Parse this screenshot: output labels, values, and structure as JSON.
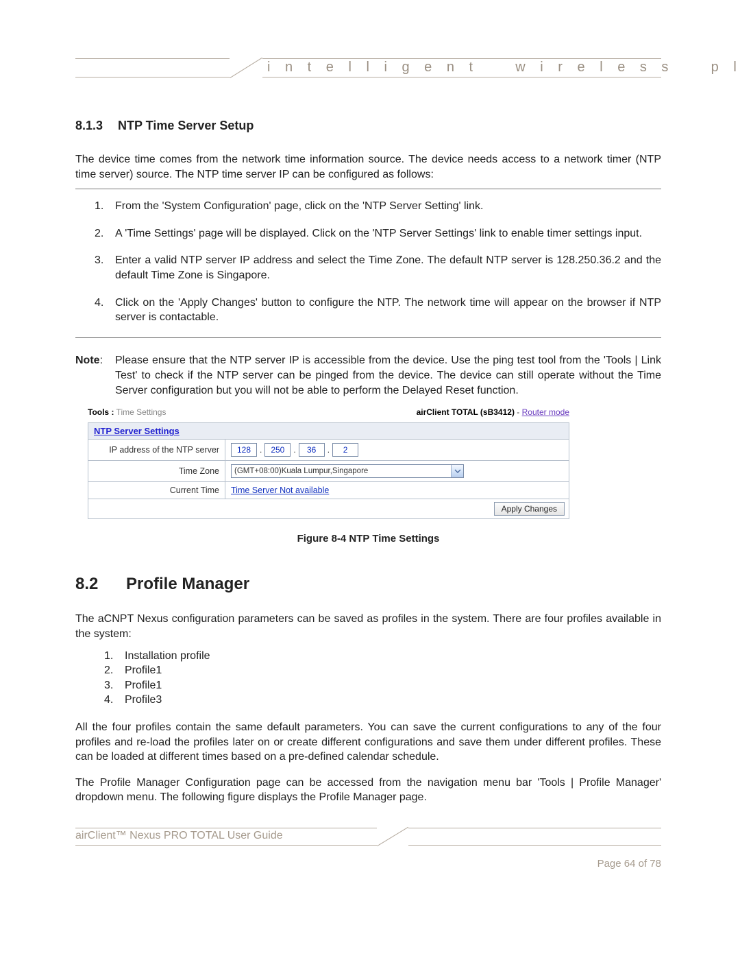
{
  "header": {
    "tagline": "i n t e l l i g e n t    w i r e l e s s    p l a t f o r m"
  },
  "section813": {
    "number": "8.1.3",
    "title": "NTP Time Server Setup",
    "intro": "The device time comes from the network time information source. The device needs access to a network timer (NTP time server) source.  The NTP time server IP can be configured as follows:",
    "steps": [
      "From the 'System Configuration' page, click on the 'NTP Server Setting' link.",
      "A 'Time Settings' page will be displayed.  Click on the 'NTP Server Settings' link to enable timer settings input.",
      "Enter a valid NTP server IP address and select the Time Zone. The default NTP server is 128.250.36.2 and the default Time Zone is Singapore.",
      "Click on the 'Apply Changes' button to configure the NTP. The network time will appear on the browser if NTP server is contactable."
    ],
    "note_label": "Note",
    "note_body": "Please ensure that the NTP server IP is accessible from the device. Use the ping test tool from the 'Tools | Link Test' to check if the NTP server can be pinged from the device.  The device can still operate without the Time Server configuration but you will not be able to perform the Delayed Reset function."
  },
  "ui": {
    "breadcrumb_bold": "Tools :",
    "breadcrumb_grey": " Time Settings",
    "product": "airClient TOTAL (sB3412)",
    "mode_sep": " - ",
    "mode_link": "Router mode",
    "tab_link": "NTP Server Settings",
    "row_ip_label": "IP address of the NTP server",
    "ip": {
      "a": "128",
      "b": "250",
      "c": "36",
      "d": "2"
    },
    "row_tz_label": "Time Zone",
    "tz_value": "(GMT+08:00)Kuala Lumpur,Singapore",
    "row_ct_label": "Current Time",
    "ct_value": "Time Server Not available",
    "apply_label": "Apply Changes"
  },
  "figure_caption": "Figure 8-4 NTP Time Settings",
  "section82": {
    "number": "8.2",
    "title": "Profile Manager",
    "intro": "The aCNPT Nexus configuration parameters can be saved as profiles in the system. There are four profiles available in the system:",
    "profiles": [
      "Installation profile",
      "Profile1",
      "Profile1",
      "Profile3"
    ],
    "para2": "All the four profiles contain the same default parameters. You can save the current configurations to any of the four profiles and re-load the profiles later on or create different configurations and save them under different profiles. These can be loaded at different times based on a pre-defined calendar schedule.",
    "para3": "The Profile Manager Configuration page can be accessed from the navigation menu bar 'Tools | Profile Manager' dropdown menu. The following figure displays the Profile Manager page."
  },
  "footer": {
    "left": "airClient™ Nexus PRO TOTAL User Guide",
    "right": "Page 64 of 78"
  }
}
